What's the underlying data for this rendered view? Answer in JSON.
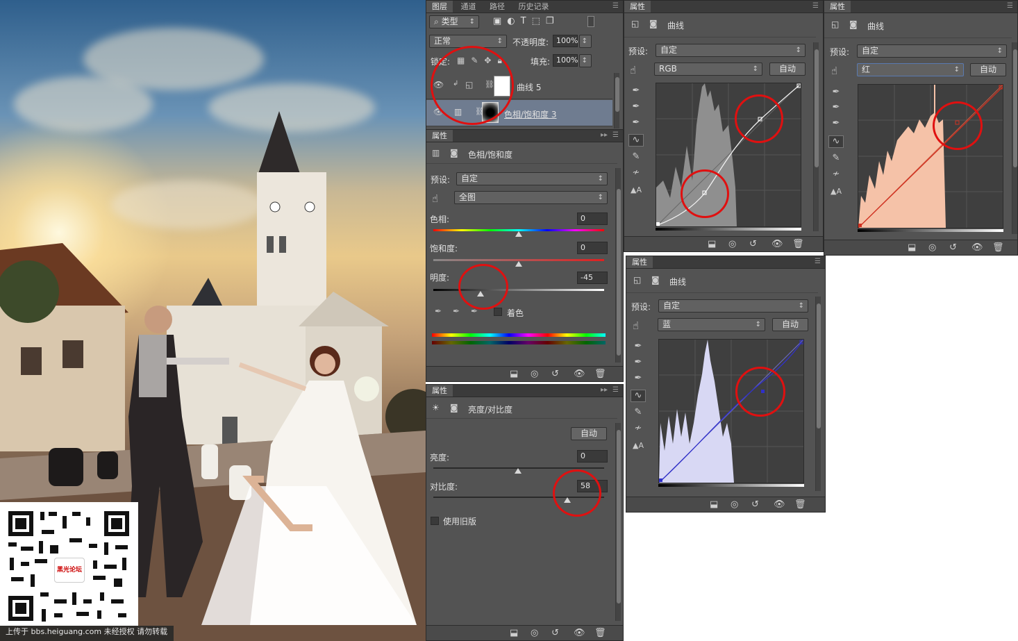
{
  "photo": {
    "watermark": "上传于 bbs.heiguang.com  未经授权  请勿转载",
    "qr_logo": "黑光论坛"
  },
  "layers_panel": {
    "tabs": [
      "图层",
      "通道",
      "路径",
      "历史记录"
    ],
    "filter_type": "类型",
    "blend_mode": "正常",
    "opacity_label": "不透明度:",
    "opacity_value": "100%",
    "lock_label": "锁定:",
    "fill_label": "填充:",
    "fill_value": "100%",
    "layers": [
      {
        "name": "曲线 5",
        "selected": false
      },
      {
        "name": "色相/饱和度 3",
        "selected": true
      }
    ]
  },
  "hue_sat_panel": {
    "tab": "属性",
    "title": "色相/饱和度",
    "preset_label": "预设:",
    "preset_value": "自定",
    "range_value": "全图",
    "hue_label": "色相:",
    "hue_value": "0",
    "saturation_label": "饱和度:",
    "saturation_value": "0",
    "lightness_label": "明度:",
    "lightness_value": "-45",
    "colorize_label": "着色"
  },
  "brightness_panel": {
    "tab": "属性",
    "title": "亮度/对比度",
    "auto_label": "自动",
    "brightness_label": "亮度:",
    "brightness_value": "0",
    "contrast_label": "对比度:",
    "contrast_value": "58",
    "legacy_label": "使用旧版"
  },
  "curves_rgb": {
    "tab": "属性",
    "title": "曲线",
    "preset_label": "预设:",
    "preset_value": "自定",
    "channel": "RGB",
    "auto_label": "自动"
  },
  "curves_red": {
    "tab": "属性",
    "title": "曲线",
    "preset_label": "预设:",
    "preset_value": "自定",
    "channel": "红",
    "auto_label": "自动"
  },
  "curves_blue": {
    "tab": "属性",
    "title": "曲线",
    "preset_label": "预设:",
    "preset_value": "自定",
    "channel": "蓝",
    "auto_label": "自动"
  },
  "colors": {
    "panel_bg": "#535353",
    "highlight_ring": "#e01010",
    "red_channel_fill": "#f5c2a8",
    "blue_channel_fill": "#d8d8f4",
    "blue_curve": "#3030c8",
    "red_curve": "#d03020"
  }
}
